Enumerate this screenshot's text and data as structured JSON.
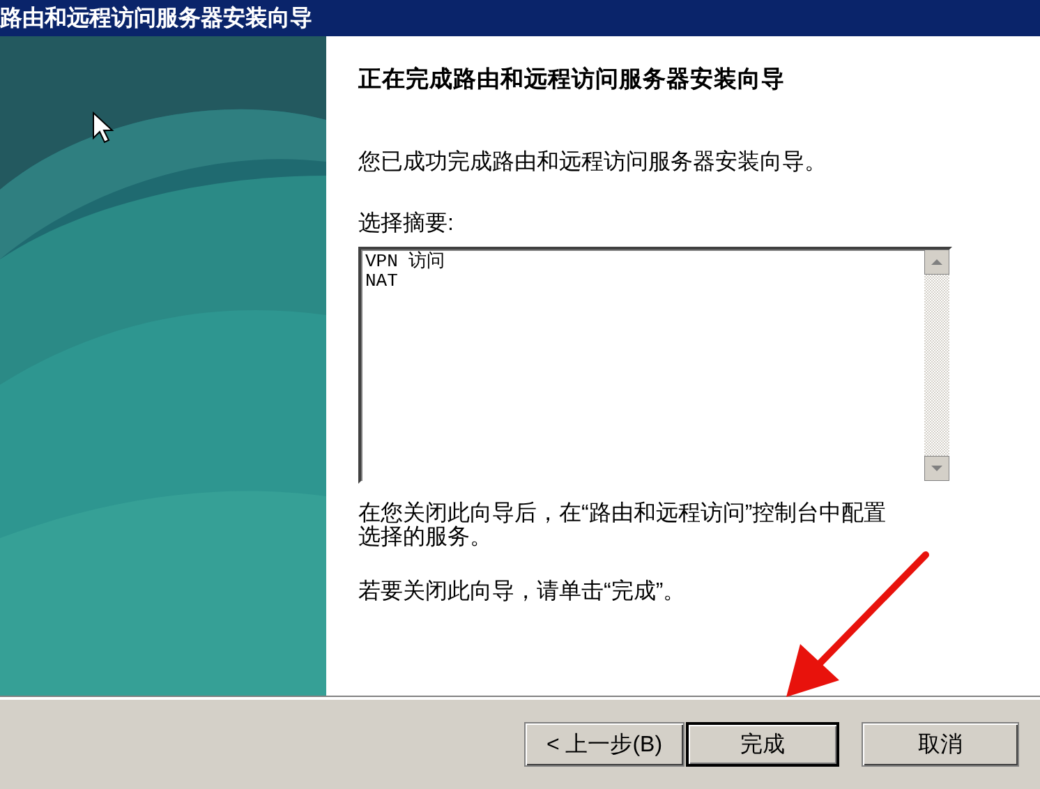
{
  "window": {
    "title": "路由和远程访问服务器安装向导"
  },
  "heading": "正在完成路由和远程访问服务器安装向导",
  "intro": "您已成功完成路由和远程访问服务器安装向导。",
  "summary": {
    "label": "选择摘要:",
    "lines": [
      "VPN 访问",
      "NAT"
    ]
  },
  "note": "在您关闭此向导后，在“路由和远程访问”控制台中配置选择的服务。",
  "close_hint": "若要关闭此向导，请单击“完成”。",
  "buttons": [
    {
      "label": "< 上一步(B)",
      "default": false
    },
    {
      "label": "完成",
      "default": true
    },
    {
      "label": "取消",
      "default": false
    }
  ]
}
